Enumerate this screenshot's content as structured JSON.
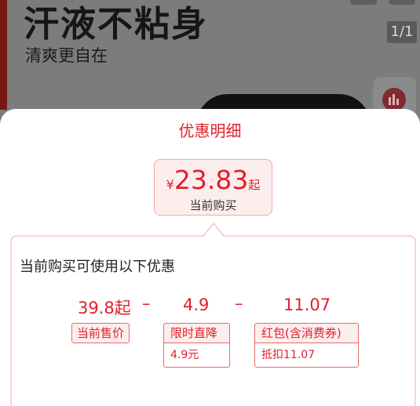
{
  "background": {
    "product_title": "汗液不粘身",
    "product_subtitle": "清爽更自在",
    "image_counter": "1/1"
  },
  "sheet": {
    "title": "优惠明细",
    "price": {
      "currency": "¥",
      "amount": "23.83",
      "suffix": "起",
      "label": "当前购买"
    },
    "panel": {
      "heading": "当前购买可使用以下优惠",
      "values": {
        "sale_price": "39.8起",
        "minus1": "–",
        "discount": "4.9",
        "minus2": "–",
        "coupon": "11.07"
      },
      "tags": {
        "sale_price": "当前售价",
        "discount_head": "限时直降",
        "discount_sub": "4.9元",
        "coupon_head": "红包(含消费券)",
        "coupon_sub": "抵扣11.07"
      }
    }
  },
  "colors": {
    "accent": "#e0202b",
    "tag_bg": "#fdeeee",
    "border": "#f0a8a8",
    "overlay": "#7c7c7c"
  }
}
